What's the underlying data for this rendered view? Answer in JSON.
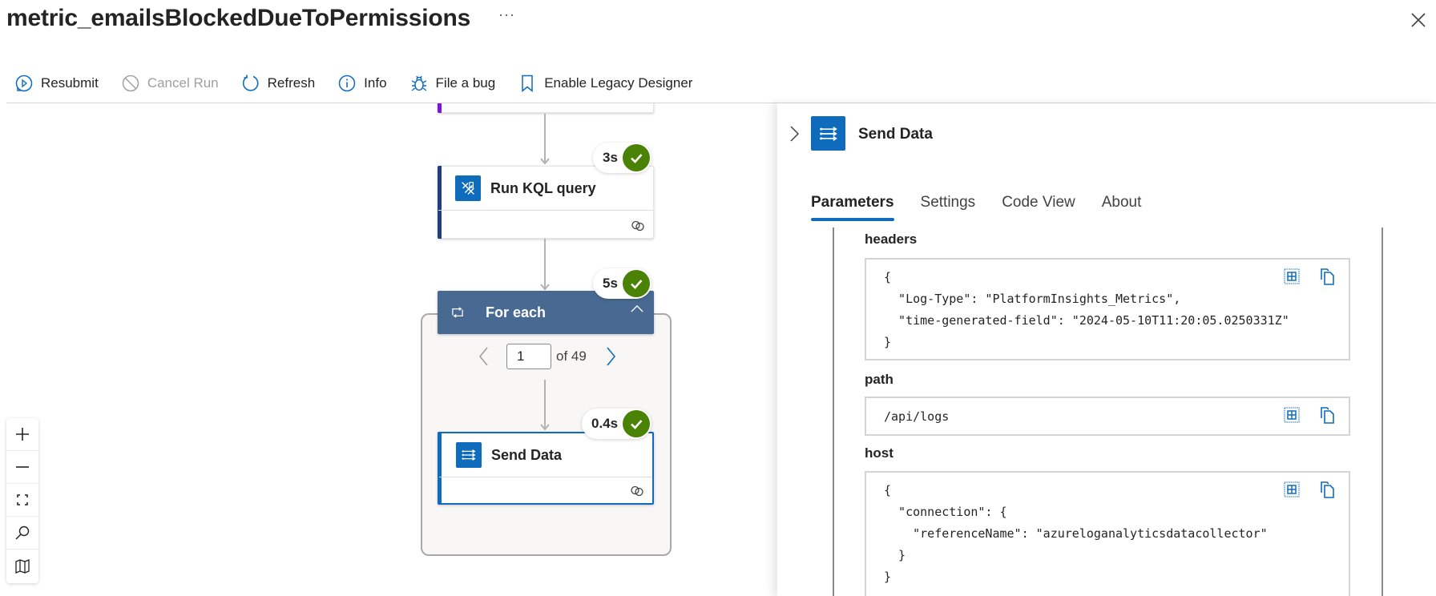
{
  "header": {
    "title": "metric_emailsBlockedDueToPermissions",
    "more_label": "···"
  },
  "toolbar": {
    "items": [
      {
        "label": "Resubmit",
        "icon": "resubmit-icon",
        "enabled": true
      },
      {
        "label": "Cancel Run",
        "icon": "cancel-icon",
        "enabled": false
      },
      {
        "label": "Refresh",
        "icon": "refresh-icon",
        "enabled": true
      },
      {
        "label": "Info",
        "icon": "info-icon",
        "enabled": true
      },
      {
        "label": "File a bug",
        "icon": "bug-icon",
        "enabled": true
      },
      {
        "label": "Enable Legacy Designer",
        "icon": "bookmark-icon",
        "enabled": true
      }
    ]
  },
  "canvas": {
    "nodes": [
      {
        "title": "",
        "accent": "#7a16d6"
      },
      {
        "title": "Run KQL query",
        "duration": "3s",
        "status": "succeeded",
        "accent": "#1f3e7a"
      },
      {
        "title": "For each",
        "duration": "5s",
        "status": "succeeded",
        "header_color": "#486991"
      },
      {
        "title": "Send Data",
        "duration": "0.4s",
        "status": "succeeded",
        "accent": "#0f6cbd",
        "selected": true
      }
    ],
    "pager": {
      "current": "1",
      "of_label": "of 49"
    },
    "zoom_controls": [
      "zoom-in",
      "zoom-out",
      "fit-view",
      "search",
      "minimap"
    ]
  },
  "panel": {
    "title": "Send Data",
    "tabs": [
      {
        "label": "Parameters",
        "active": true
      },
      {
        "label": "Settings",
        "active": false
      },
      {
        "label": "Code View",
        "active": false
      },
      {
        "label": "About",
        "active": false
      }
    ],
    "params": [
      {
        "label": "headers",
        "value": "{\n  \"Log-Type\": \"PlatformInsights_Metrics\",\n  \"time-generated-field\": \"2024-05-10T11:20:05.0250331Z\"\n}"
      },
      {
        "label": "path",
        "value": "/api/logs"
      },
      {
        "label": "host",
        "value": "{\n  \"connection\": {\n    \"referenceName\": \"azureloganalyticsdatacollector\"\n  }\n}"
      }
    ]
  },
  "colors": {
    "accent": "#0f6cbd",
    "success": "#498205",
    "foreach_header": "#486991"
  }
}
